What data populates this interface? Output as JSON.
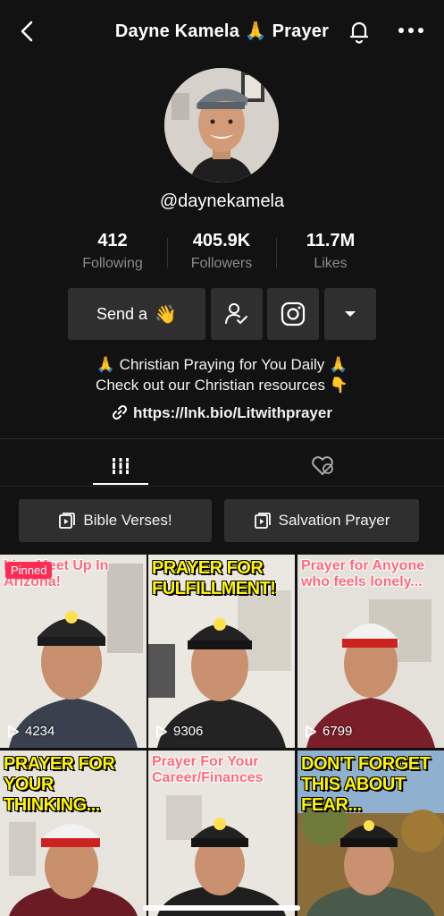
{
  "header": {
    "title": "Dayne Kamela 🙏 Prayer",
    "back_icon": "chevron-left-icon",
    "bell_icon": "bell-icon",
    "more_icon": "ellipsis-icon"
  },
  "profile": {
    "handle": "@daynekamela",
    "stats": [
      {
        "value": "412",
        "label": "Following"
      },
      {
        "value": "405.9K",
        "label": "Followers"
      },
      {
        "value": "11.7M",
        "label": "Likes"
      }
    ],
    "send_button": "Send a",
    "send_emoji": "👋",
    "bio_line1": "🙏 Christian Praying for You Daily 🙏",
    "bio_line2": "Check out our Christian resources 👇",
    "link": "https://lnk.bio/Litwithprayer"
  },
  "tabs": [
    {
      "name": "videos",
      "icon": "grid-icon",
      "active": true
    },
    {
      "name": "liked",
      "icon": "liked-hidden-icon",
      "active": false
    }
  ],
  "playlists": [
    "Bible Verses!",
    "Salvation Prayer"
  ],
  "videos": [
    {
      "caption": "Live Meet Up In Arizona!",
      "style": "pink",
      "pinned": "Pinned",
      "views": "4234"
    },
    {
      "caption": "PRAYER FOR FULFILLMENT!",
      "style": "yellow",
      "views": "9306"
    },
    {
      "caption": "Prayer for Anyone who feels lonely...",
      "style": "pink",
      "views": "6799"
    },
    {
      "caption": "PRAYER FOR YOUR THINKING...",
      "style": "yellow",
      "views": ""
    },
    {
      "caption": "Prayer For Your Career/Finances",
      "style": "pink",
      "views": ""
    },
    {
      "caption": "DON'T FORGET THIS ABOUT FEAR...",
      "style": "yellow",
      "views": ""
    }
  ],
  "colors": {
    "background": "#121212",
    "button": "#2f2f2f",
    "pinned": "#fe2c55",
    "caption_yellow": "#fff400",
    "caption_pink": "#ff6a7a"
  }
}
